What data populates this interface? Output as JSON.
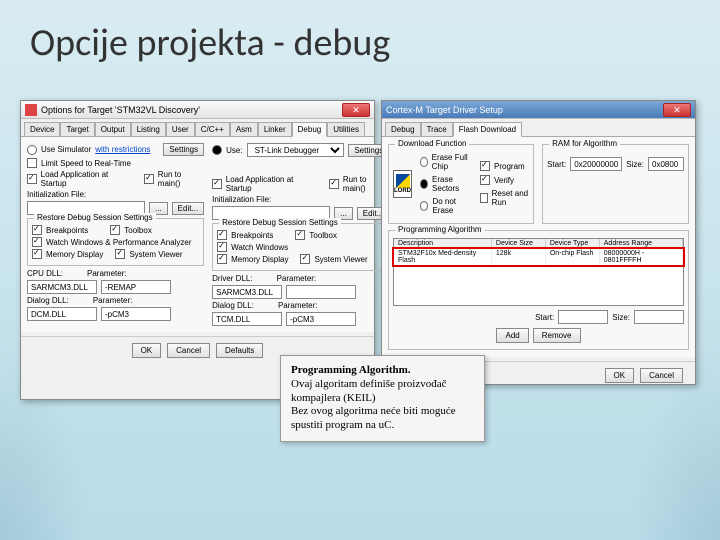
{
  "slide": {
    "title": "Opcije projekta - debug"
  },
  "options_dialog": {
    "title": "Options for Target 'STM32VL Discovery'",
    "tabs": [
      "Device",
      "Target",
      "Output",
      "Listing",
      "User",
      "C/C++",
      "Asm",
      "Linker",
      "Debug",
      "Utilities"
    ],
    "active_tab": "Debug",
    "left": {
      "use_sim_label": "Use Simulator",
      "with_restrictions": "with restrictions",
      "settings": "Settings",
      "limit_speed": "Limit Speed to Real-Time",
      "load_app": "Load Application at Startup",
      "run_to_main": "Run to main()",
      "init_label": "Initialization File:",
      "edit": "Edit...",
      "group_title": "Restore Debug Session Settings",
      "breakpoints": "Breakpoints",
      "toolbox": "Toolbox",
      "watch": "Watch Windows & Performance Analyzer",
      "mem": "Memory Display",
      "sysv": "System Viewer",
      "cpu_dll": "CPU DLL:",
      "param": "Parameter:",
      "cpu_dll_val": "SARMCM3.DLL",
      "cpu_param_val": "-REMAP",
      "dlg_dll": "Dialog DLL:",
      "dlg_dll_val": "DCM.DLL",
      "dlg_param_val": "-pCM3"
    },
    "right": {
      "use_label": "Use:",
      "driver": "ST-Link Debugger",
      "settings": "Settings",
      "load_app": "Load Application at Startup",
      "run_to_main": "Run to main()",
      "init_label": "Initialization File:",
      "edit": "Edit...",
      "group_title": "Restore Debug Session Settings",
      "breakpoints": "Breakpoints",
      "toolbox": "Toolbox",
      "watch": "Watch Windows",
      "mem": "Memory Display",
      "sysv": "System Viewer",
      "drv_dll": "Driver DLL:",
      "param": "Parameter:",
      "drv_dll_val": "SARMCM3.DLL",
      "dlg_dll": "Dialog DLL:",
      "dlg_dll_val": "TCM.DLL",
      "dlg_param_val": "-pCM3"
    },
    "buttons": {
      "ok": "OK",
      "cancel": "Cancel",
      "defaults": "Defaults"
    }
  },
  "driver_dialog": {
    "title": "Cortex-M Target Driver Setup",
    "tabs": [
      "Debug",
      "Trace",
      "Flash Download"
    ],
    "active_tab": "Flash Download",
    "download_group": "Download Function",
    "lord_label": "LORD",
    "erase_full": "Erase Full Chip",
    "erase_sectors": "Erase Sectors",
    "do_not_erase": "Do not Erase",
    "program": "Program",
    "verify": "Verify",
    "reset_run": "Reset and Run",
    "ram_group": "RAM for Algorithm",
    "start_label": "Start:",
    "start_val": "0x20000000",
    "size_label": "Size:",
    "size_val": "0x0800",
    "prog_alg_group": "Programming Algorithm",
    "cols": {
      "desc": "Description",
      "size": "Device Size",
      "type": "Device Type",
      "range": "Address Range"
    },
    "row": {
      "desc": "STM32F10x Med-density Flash",
      "size": "128k",
      "type": "On-chip Flash",
      "range": "08000000H - 0801FFFFH"
    },
    "start2_label": "Start:",
    "size2_label": "Size:",
    "add": "Add",
    "remove": "Remove",
    "ok": "OK",
    "cancel": "Cancel"
  },
  "callout": {
    "l1": "Programming Algorithm.",
    "l2": "Ovaj algoritam definiše proizvođač kompajlera (KEIL)",
    "l3": "Bez ovog algoritma neće biti moguće spustiti program na uC."
  }
}
